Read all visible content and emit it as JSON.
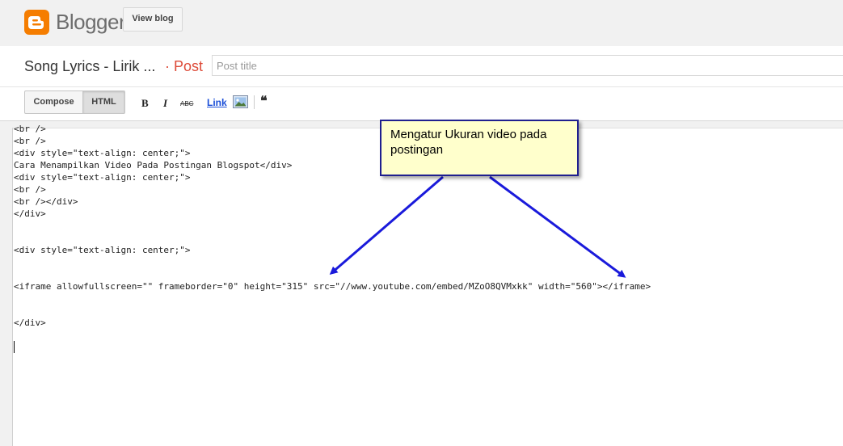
{
  "header": {
    "brand": "Blogger",
    "view_blog_label": "View blog"
  },
  "title_bar": {
    "blog_name": "Song Lyrics - Lirik ...",
    "separator": "· Post",
    "post_title_placeholder": "Post title"
  },
  "toolbar": {
    "compose_label": "Compose",
    "html_label": "HTML",
    "bold_label": "B",
    "italic_label": "I",
    "strike_label": "ABC",
    "link_label": "Link",
    "quote_label": "❝"
  },
  "editor": {
    "lines": [
      "<br />",
      "<br />",
      "<div style=\"text-align: center;\">",
      "Cara Menampilkan Video Pada Postingan Blogspot</div>",
      "<div style=\"text-align: center;\">",
      "<br />",
      "<br /></div>",
      "</div>",
      "<div style=\"text-align: center;\">",
      "<iframe allowfullscreen=\"\" frameborder=\"0\" height=\"315\" src=\"//www.youtube.com/embed/MZoO8QVMxkk\" width=\"560\"></iframe>",
      "</div>"
    ]
  },
  "annotation": {
    "text": "Mengatur Ukuran video pada postingan"
  },
  "colors": {
    "brand_orange": "#f57d00",
    "post_accent": "#dd4b39",
    "arrow_blue": "#1a1adb",
    "callout_bg": "#ffffcc"
  }
}
